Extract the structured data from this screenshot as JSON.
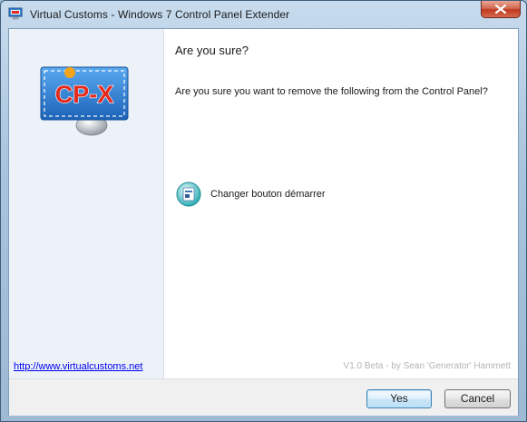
{
  "window": {
    "title": "Virtual Customs - Windows 7 Control Panel Extender",
    "app_icon": "cpx-app-icon",
    "close_icon": "close-icon"
  },
  "sidebar": {
    "logo_text": "CP-X",
    "logo_icon": "cpx-logo",
    "link": "http://www.virtualcustoms.net"
  },
  "main": {
    "heading": "Are you sure?",
    "question": "Are you sure you want to remove the following from the Control Panel?",
    "items": [
      {
        "label": "Changer bouton démarrer",
        "icon": "start-button-icon"
      }
    ],
    "credit": "V1.0 Beta - by Sean 'Generator' Hammett"
  },
  "buttons": {
    "yes": "Yes",
    "cancel": "Cancel"
  },
  "colors": {
    "link": "#0000ee",
    "sidebar_bg": "#ecf2f8",
    "logo_red": "#e42a1c",
    "logo_blue": "#2f7fd6"
  }
}
